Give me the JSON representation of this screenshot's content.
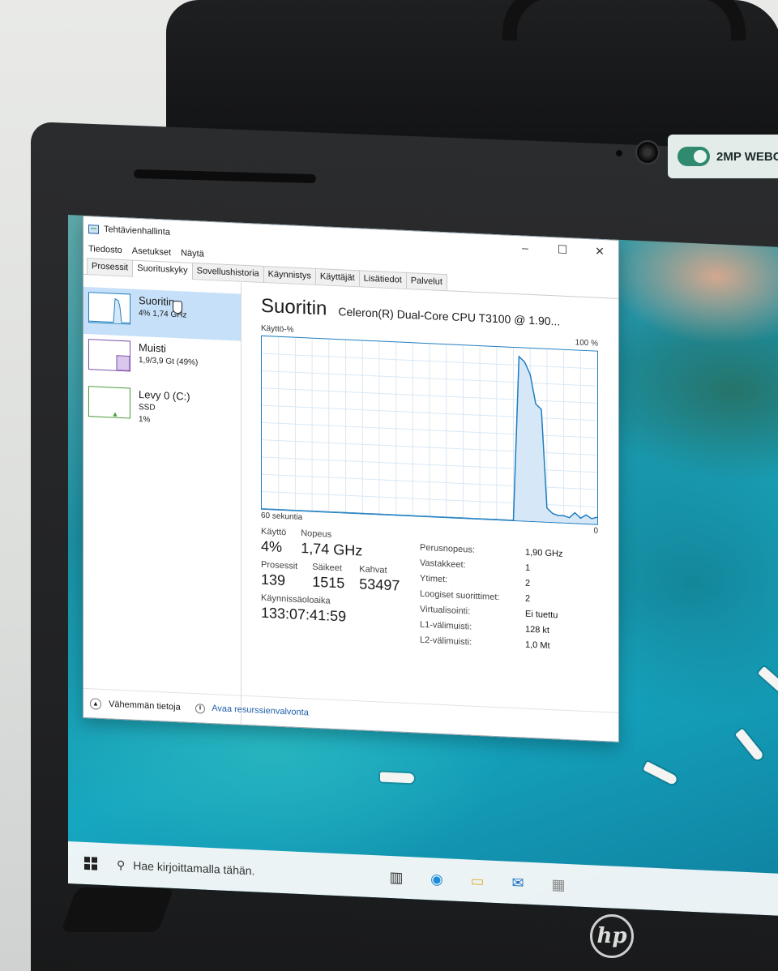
{
  "colors": {
    "accent": "#1f7dc0",
    "graph_fill": "#d6e8f7",
    "sidebar_active": "#c5e0f8",
    "disk_green": "#4c9a3a",
    "memory_purple": "#7b4fa8"
  },
  "webcam_sticker": {
    "text": "2MP WEBC"
  },
  "window": {
    "title": "Tehtävienhallinta",
    "controls": [
      "–",
      "☐",
      "✕"
    ]
  },
  "menu": [
    "Tiedosto",
    "Asetukset",
    "Näytä"
  ],
  "tabs": [
    {
      "label": "Prosessit",
      "active": false
    },
    {
      "label": "Suorituskyky",
      "active": true
    },
    {
      "label": "Sovellushistoria",
      "active": false
    },
    {
      "label": "Käynnistys",
      "active": false
    },
    {
      "label": "Käyttäjät",
      "active": false
    },
    {
      "label": "Lisätiedot",
      "active": false
    },
    {
      "label": "Palvelut",
      "active": false
    }
  ],
  "sidebar": {
    "items": [
      {
        "name": "Suoritin",
        "line1": "4% 1,74 GHz",
        "line2": "",
        "line3": ""
      },
      {
        "name": "Muisti",
        "line1": "1,9/3,9 Gt (49%)",
        "line2": "",
        "line3": ""
      },
      {
        "name": "Levy 0 (C:)",
        "line1": "SSD",
        "line2": "1%",
        "line3": ""
      }
    ]
  },
  "main": {
    "title": "Suoritin",
    "cpu_name": "Celeron(R) Dual-Core CPU T3100 @ 1.90...",
    "graph_label_left": "Käyttö-%",
    "graph_label_right": "100 %",
    "graph_foot_left": "60 sekuntia",
    "graph_foot_right": "0",
    "stats": {
      "usage_label": "Käyttö",
      "usage_value": "4%",
      "speed_label": "Nopeus",
      "speed_value": "1,74 GHz",
      "processes_label": "Prosessit",
      "processes_value": "139",
      "threads_label": "Säikeet",
      "threads_value": "1515",
      "handles_label": "Kahvat",
      "handles_value": "53497",
      "uptime_label": "Käynnissäoloaika",
      "uptime_value": "133:07:41:59"
    },
    "details": [
      {
        "key": "Perusnopeus:",
        "value": "1,90 GHz"
      },
      {
        "key": "Vastakkeet:",
        "value": "1"
      },
      {
        "key": "Ytimet:",
        "value": "2"
      },
      {
        "key": "Loogiset suorittimet:",
        "value": "2"
      },
      {
        "key": "Virtualisointi:",
        "value": "Ei tuettu"
      },
      {
        "key": "L1-välimuisti:",
        "value": "128 kt"
      },
      {
        "key": "L2-välimuisti:",
        "value": "1,0 Mt"
      }
    ]
  },
  "footer": {
    "fewer_details": "Vähemmän tietoja",
    "open_monitor": "Avaa resurssienvalvonta"
  },
  "taskbar": {
    "search_placeholder": "Hae kirjoittamalla tähän."
  },
  "brand": {
    "logo": "hp"
  },
  "chart_data": {
    "type": "area",
    "title": "",
    "xlabel": "60 sekuntia",
    "ylabel": "Käyttö-%",
    "ylim": [
      0,
      100
    ],
    "x": [
      60,
      57,
      54,
      51,
      48,
      45,
      42,
      39,
      36,
      33,
      30,
      27,
      24,
      21,
      18,
      15,
      14,
      13,
      12,
      11,
      10,
      9,
      8,
      7,
      6,
      5,
      4,
      3,
      2,
      1,
      0
    ],
    "series": [
      {
        "values": [
          0,
          0,
          0,
          0,
          0,
          0,
          0,
          0,
          0,
          0,
          0,
          0,
          0,
          0,
          0,
          0,
          95,
          92,
          85,
          68,
          65,
          8,
          5,
          4,
          4,
          3,
          6,
          3,
          5,
          3,
          4
        ]
      }
    ]
  }
}
